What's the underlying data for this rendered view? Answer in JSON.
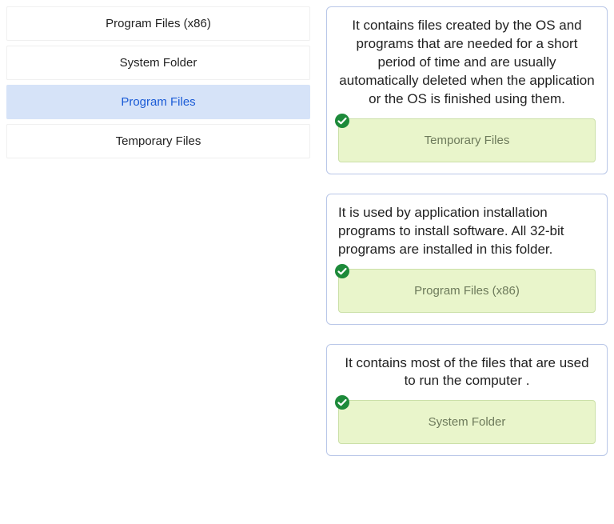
{
  "left_items": [
    {
      "id": "pf86",
      "label": "Program Files (x86)",
      "selected": false
    },
    {
      "id": "sys",
      "label": "System Folder",
      "selected": false
    },
    {
      "id": "pf",
      "label": "Program Files",
      "selected": true
    },
    {
      "id": "tmp",
      "label": "Temporary Files",
      "selected": false
    }
  ],
  "cards": [
    {
      "id": "card-tmp",
      "align": "centered",
      "description": "It contains files created by the OS and programs that are needed for a short period of time and are usually automatically deleted when the application or the OS is finished using them.",
      "answer": "Temporary Files",
      "correct": true
    },
    {
      "id": "card-pf86",
      "align": "left",
      "description": "It is used by application installation programs to install software. All 32-bit programs are installed in this folder.",
      "answer": "Program Files (x86)",
      "correct": true
    },
    {
      "id": "card-sys",
      "align": "centered",
      "description": "It contains most of the files that are used to run the computer .",
      "answer": "System Folder",
      "correct": true
    }
  ],
  "colors": {
    "accent": "#1a5bd6",
    "slot_bg": "#e9f5cb",
    "slot_border": "#cbe0a8",
    "check": "#1d8a3a"
  }
}
